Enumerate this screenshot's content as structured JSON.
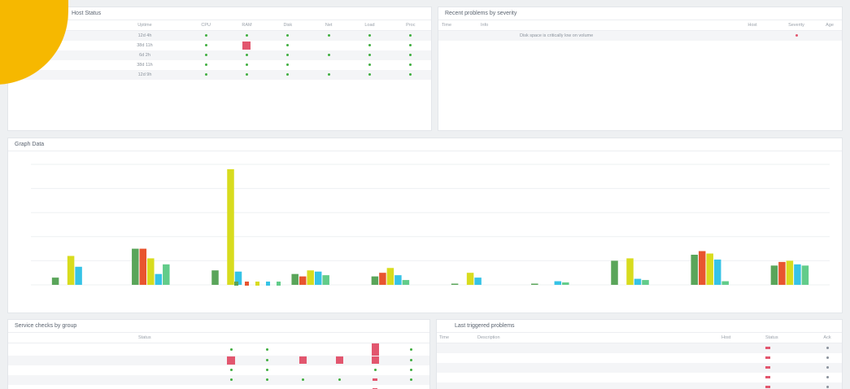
{
  "colors": {
    "accent": "#f6b800",
    "bad": "#e2566e",
    "ok": "#3fae3f"
  },
  "top_left": {
    "title": "Host Status",
    "columns": [
      "",
      "Uptime",
      "CPU",
      "RAM",
      "Disk",
      "Net",
      "Load",
      "Proc"
    ],
    "rows": [
      {
        "name": "",
        "uptime": "12d 4h"
      },
      {
        "name": "",
        "uptime": "38d 11h"
      },
      {
        "name": "",
        "uptime": "6d 2h"
      },
      {
        "name": "",
        "uptime": "38d 11h"
      },
      {
        "name": "",
        "uptime": "12d 9h"
      }
    ]
  },
  "top_right": {
    "title": "Recent problems by severity",
    "columns": [
      "Time",
      "Info",
      "Host",
      "Severity",
      "Age"
    ],
    "rows": [
      {
        "time": "",
        "info": "Disk space is critically low on volume",
        "host": "",
        "age": ""
      }
    ]
  },
  "middle": {
    "title": "Graph Data",
    "subtitle": ""
  },
  "chart_data": {
    "type": "bar",
    "title": "",
    "xlabel": "",
    "ylabel": "",
    "ylim": [
      0,
      100
    ],
    "yticks": [
      "",
      "",
      "",
      "",
      "",
      ""
    ],
    "categories": [
      "",
      "",
      "",
      "",
      "",
      "",
      "",
      "",
      "",
      ""
    ],
    "series": [
      {
        "name": "",
        "color": "#5aa55a",
        "values": [
          6,
          30,
          12,
          9,
          7,
          1,
          1,
          20,
          25,
          16
        ]
      },
      {
        "name": "",
        "color": "#e8552f",
        "values": [
          0,
          30,
          0,
          7,
          10,
          0,
          0,
          0,
          28,
          19
        ]
      },
      {
        "name": "",
        "color": "#d8dc1e",
        "values": [
          24,
          22,
          96,
          12,
          14,
          10,
          0,
          22,
          26,
          20
        ]
      },
      {
        "name": "",
        "color": "#36c3e6",
        "values": [
          15,
          9,
          11,
          11,
          8,
          6,
          3,
          5,
          21,
          17
        ]
      },
      {
        "name": "",
        "color": "#62cc8a",
        "values": [
          0,
          17,
          0,
          8,
          4,
          0,
          2,
          4,
          3,
          16
        ]
      }
    ]
  },
  "bottom_left": {
    "title": "Service checks by group",
    "columns": [
      "",
      "Status",
      "",
      "",
      "",
      "",
      "",
      ""
    ],
    "rows": [
      {
        "name": "",
        "status": ""
      },
      {
        "name": "",
        "status": ""
      },
      {
        "name": "",
        "status": ""
      },
      {
        "name": "",
        "status": ""
      },
      {
        "name": "",
        "status": ""
      }
    ]
  },
  "bottom_right": {
    "title": "Last triggered problems",
    "columns": [
      "Time",
      "Description",
      "Host",
      "Status",
      "Ack"
    ],
    "rows": [
      {
        "time": "",
        "desc": "",
        "host": ""
      },
      {
        "time": "",
        "desc": "",
        "host": ""
      },
      {
        "time": "",
        "desc": "",
        "host": ""
      },
      {
        "time": "",
        "desc": "",
        "host": ""
      },
      {
        "time": "",
        "desc": "",
        "host": ""
      }
    ]
  }
}
